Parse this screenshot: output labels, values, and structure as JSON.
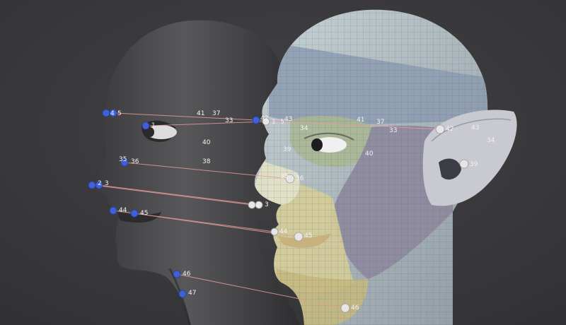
{
  "viewport": {
    "background": "#3b3b3d",
    "source_mesh_color": "#4a4a4c",
    "target_mesh_color": "#b8c2c8",
    "source_point_color": "#3f5fd6",
    "target_point_color": "#e8e8e8",
    "link_color": "#e79a9a"
  },
  "regions": [
    {
      "name": "scalp",
      "color": "#9aa7ad"
    },
    {
      "name": "forehead",
      "color": "#8fa0b4"
    },
    {
      "name": "orbit",
      "color": "#aeb98f"
    },
    {
      "name": "cheek",
      "color": "#8f8aa0"
    },
    {
      "name": "mouth",
      "color": "#d8cf9e"
    },
    {
      "name": "jaw",
      "color": "#c6bc84"
    },
    {
      "name": "nose",
      "color": "#e0e0c4"
    },
    {
      "name": "ear",
      "color": "#c8c8d0"
    }
  ],
  "labels": {
    "s1": "1",
    "s2": "2",
    "s3": "3",
    "s4": "4",
    "s5": "5",
    "s35": "35",
    "s36": "36",
    "s37": "37",
    "s38": "38",
    "s40": "40",
    "s41": "41",
    "s33": "33",
    "s44": "44",
    "s45": "45",
    "s46": "46",
    "s47": "47",
    "t42": "42",
    "t1": "1",
    "t5": "5",
    "t43": "43",
    "t34": "34",
    "t41": "41",
    "t37": "37",
    "t33": "33",
    "t39": "39",
    "t40": "40",
    "t35": "35",
    "t36": "36",
    "t2": "2",
    "t3": "3",
    "t44": "44",
    "t45": "45",
    "t46": "46",
    "e42": "42",
    "e43": "43",
    "e34": "34",
    "e39": "39"
  }
}
